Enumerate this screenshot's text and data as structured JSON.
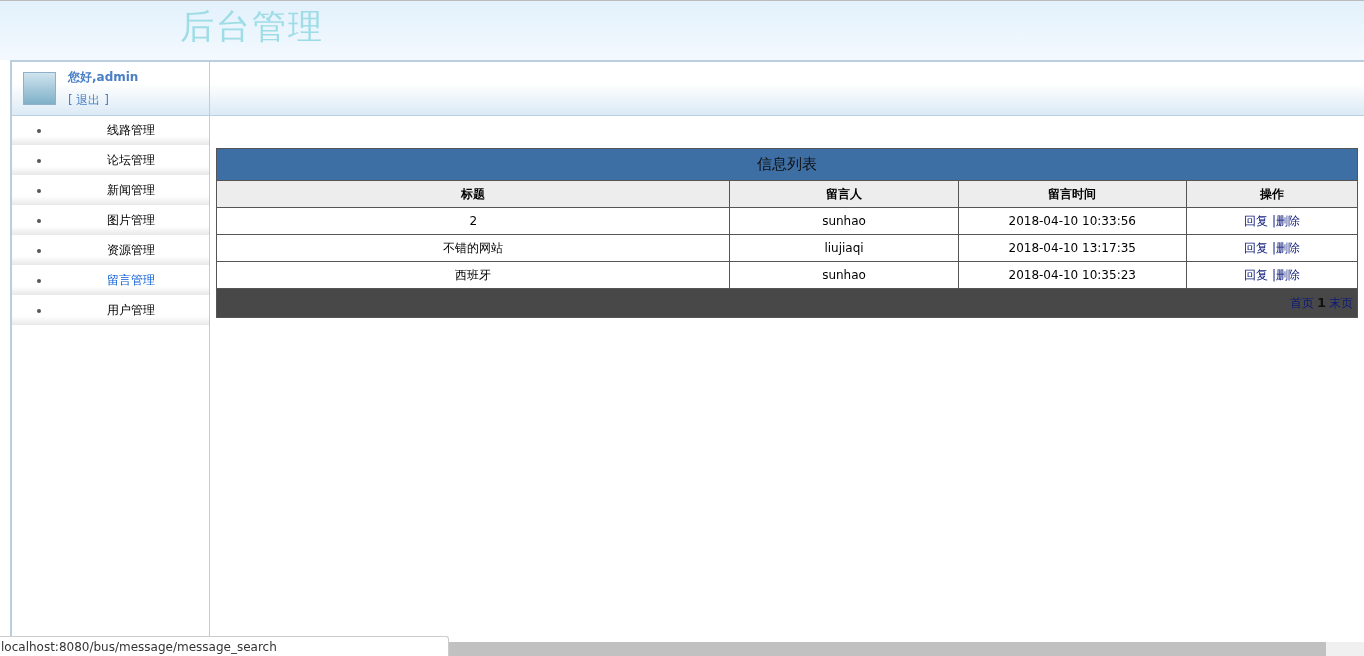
{
  "header": {
    "logo": "后台管理"
  },
  "user": {
    "greeting": "您好,admin",
    "logout": "[ 退出 ]"
  },
  "sidebar": {
    "items": [
      {
        "label": "线路管理",
        "selected": false
      },
      {
        "label": "论坛管理",
        "selected": false
      },
      {
        "label": "新闻管理",
        "selected": false
      },
      {
        "label": "图片管理",
        "selected": false
      },
      {
        "label": "资源管理",
        "selected": false
      },
      {
        "label": "留言管理",
        "selected": true
      },
      {
        "label": "用户管理",
        "selected": false
      }
    ]
  },
  "table": {
    "title": "信息列表",
    "columns": [
      "标题",
      "留言人",
      "留言时间",
      "操作"
    ],
    "rows": [
      {
        "title": "2",
        "author": "sunhao",
        "time": "2018-04-10 10:33:56",
        "actions": [
          "回复",
          "|删除"
        ]
      },
      {
        "title": "不错的网站",
        "author": "liujiaqi",
        "time": "2018-04-10 13:17:35",
        "actions": [
          "回复",
          "|删除"
        ]
      },
      {
        "title": "西班牙",
        "author": "sunhao",
        "time": "2018-04-10 10:35:23",
        "actions": [
          "回复",
          "|删除"
        ]
      }
    ],
    "pager": {
      "first": "首页",
      "current": "1",
      "last": "末页"
    }
  },
  "status_bar": {
    "url": "localhost:8080/bus/message/message_search"
  }
}
